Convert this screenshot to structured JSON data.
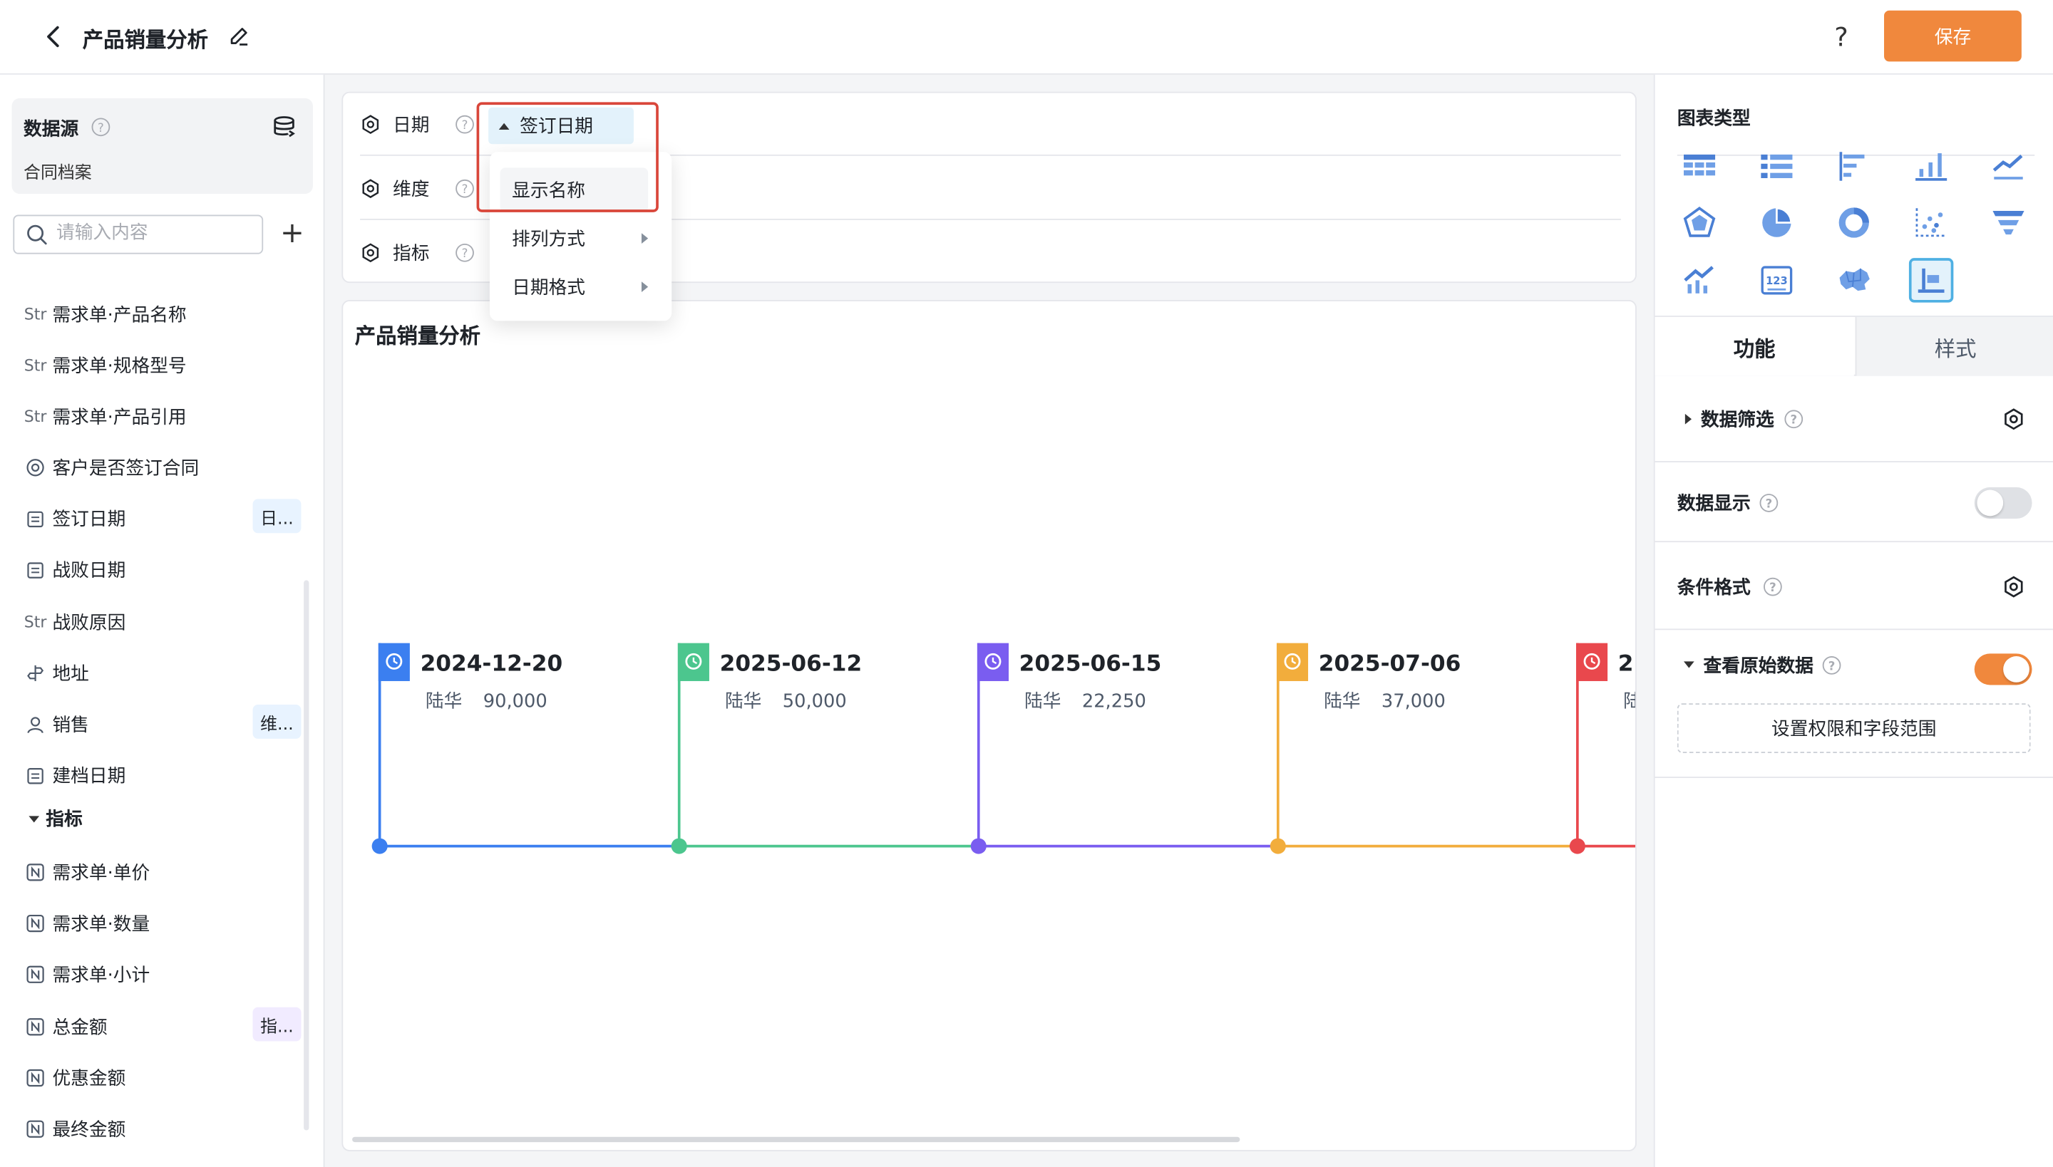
{
  "header": {
    "title": "产品销量分析",
    "help": "?",
    "save_label": "保存"
  },
  "datasource": {
    "title": "数据源",
    "name": "合同档案"
  },
  "search": {
    "placeholder": "请输入内容",
    "value": ""
  },
  "fields": [
    {
      "type": "Str",
      "label": "需求单·产品名称"
    },
    {
      "type": "Str",
      "label": "需求单·规格型号"
    },
    {
      "type": "Str",
      "label": "需求单·产品引用"
    },
    {
      "type": "radio",
      "label": "客户是否签订合同"
    },
    {
      "type": "date",
      "label": "签订日期",
      "tag": "日..."
    },
    {
      "type": "date",
      "label": "战败日期"
    },
    {
      "type": "Str",
      "label": "战败原因"
    },
    {
      "type": "address",
      "label": "地址"
    },
    {
      "type": "user",
      "label": "销售",
      "tag": "维..."
    },
    {
      "type": "date",
      "label": "建档日期"
    }
  ],
  "metrics_group": {
    "title": "指标",
    "items": [
      {
        "type": "N",
        "label": "需求单·单价"
      },
      {
        "type": "N",
        "label": "需求单·数量"
      },
      {
        "type": "N",
        "label": "需求单·小计"
      },
      {
        "type": "N",
        "label": "总金额",
        "tag": "指..."
      },
      {
        "type": "N",
        "label": "优惠金额"
      },
      {
        "type": "N",
        "label": "最终金额"
      }
    ]
  },
  "config": {
    "rows": [
      {
        "label": "日期"
      },
      {
        "label": "维度"
      },
      {
        "label": "指标"
      }
    ],
    "date_chip": "签订日期"
  },
  "menu": {
    "items": [
      "显示名称",
      "排列方式",
      "日期格式"
    ]
  },
  "chart": {
    "title": "产品销量分析"
  },
  "chart_data": {
    "type": "timeline",
    "events": [
      {
        "date": "2024-12-20",
        "name": "陆华",
        "value": "90,000",
        "color": "#3b7ff0"
      },
      {
        "date": "2025-06-12",
        "name": "陆华",
        "value": "50,000",
        "color": "#4cc68e"
      },
      {
        "date": "2025-06-15",
        "name": "陆华",
        "value": "22,250",
        "color": "#7a5df0"
      },
      {
        "date": "2025-07-06",
        "name": "陆华",
        "value": "37,000",
        "color": "#f2ad3c"
      },
      {
        "date": "2",
        "name": "陆",
        "value": "",
        "color": "#e9484d"
      }
    ]
  },
  "right_panel": {
    "chart_types_title": "图表类型",
    "chart_types": [
      "table-icon",
      "list-icon",
      "bar-horizontal-icon",
      "bar-vertical-icon",
      "line-icon",
      "radar-icon",
      "pie-icon",
      "donut-icon",
      "scatter-icon",
      "funnel-icon",
      "combo-icon",
      "number-card-icon",
      "map-icon",
      "timeline-icon"
    ],
    "selected_type": "timeline-icon",
    "tabs": [
      "功能",
      "样式"
    ],
    "active_tab": "功能",
    "data_filter": "数据筛选",
    "data_display": "数据显示",
    "data_display_on": false,
    "conditional_format": "条件格式",
    "view_raw": "查看原始数据",
    "view_raw_on": true,
    "perm_button": "设置权限和字段范围"
  },
  "colors": {
    "accent": "#f0883d",
    "highlight": "#d9463a",
    "chip": "#e3f2fb"
  }
}
